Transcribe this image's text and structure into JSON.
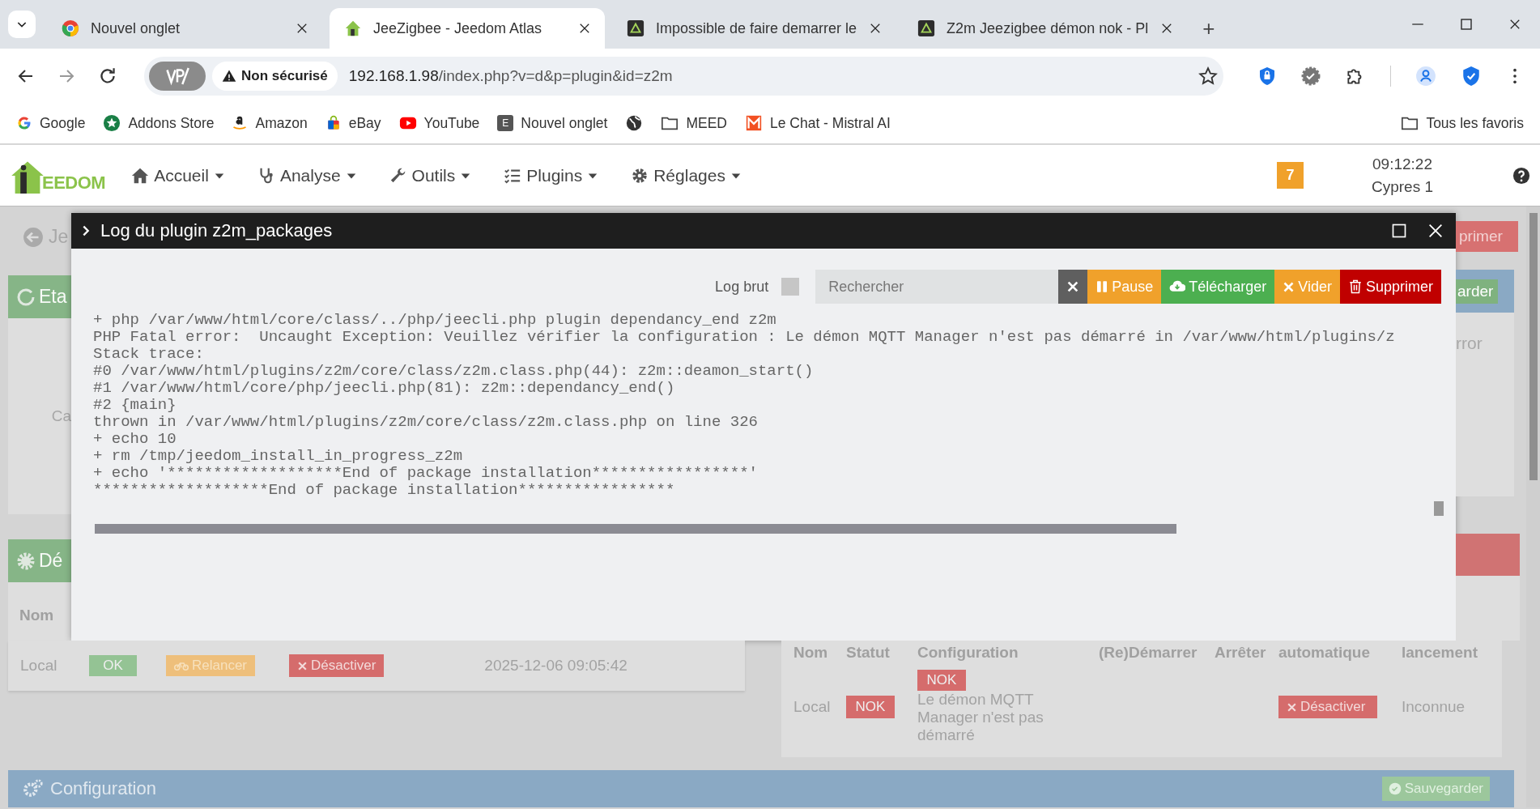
{
  "browser": {
    "tabs": [
      {
        "title": "Nouvel onglet",
        "selected": false
      },
      {
        "title": "JeeZigbee - Jeedom Atlas",
        "selected": true
      },
      {
        "title": "Impossible de faire demarrer le",
        "selected": false
      },
      {
        "title": "Z2m Jeezigbee démon nok - Pl",
        "selected": false
      }
    ],
    "new_tab": "+",
    "security_label": "Non sécurisé",
    "url_host": "192.168.1.98",
    "url_path": "/index.php?v=d&p=plugin&id=z2m",
    "bookmarks": [
      {
        "label": "Google",
        "kind": "google"
      },
      {
        "label": "Addons Store",
        "kind": "addons"
      },
      {
        "label": "Amazon",
        "kind": "amazon"
      },
      {
        "label": "eBay",
        "kind": "ebay"
      },
      {
        "label": "YouTube",
        "kind": "youtube"
      },
      {
        "label": "Nouvel onglet",
        "kind": "letter",
        "icon_text": "E"
      },
      {
        "kind": "globe"
      },
      {
        "label": "MEED",
        "kind": "folder"
      },
      {
        "label": "Le Chat - Mistral AI",
        "kind": "mistral"
      }
    ],
    "all_bookmarks": "Tous les favoris"
  },
  "app": {
    "logo_text": "EEDOM",
    "nav": [
      {
        "label": "Accueil"
      },
      {
        "label": "Analyse"
      },
      {
        "label": "Outils"
      },
      {
        "label": "Plugins"
      },
      {
        "label": "Réglages"
      }
    ],
    "badge": "7",
    "time": "09:12:22",
    "site": "Cypres 1"
  },
  "modal": {
    "title": "Log du plugin z2m_packages",
    "log_raw_label": "Log brut",
    "log_raw_checked": false,
    "search_placeholder": "Rechercher",
    "buttons": [
      {
        "kind": "clear"
      },
      {
        "kind": "pause",
        "label": "Pause"
      },
      {
        "kind": "download",
        "label": "Télécharger"
      },
      {
        "kind": "empty",
        "label": "Vider"
      },
      {
        "kind": "delete",
        "label": "Supprimer"
      }
    ],
    "log_lines": [
      "+ php /var/www/html/core/class/../php/jeecli.php plugin dependancy_end z2m",
      "PHP Fatal error:  Uncaught Exception: Veuillez vérifier la configuration : Le démon MQTT Manager n'est pas démarré in /var/www/html/plugins/z",
      "Stack trace:",
      "#0 /var/www/html/plugins/z2m/core/class/z2m.class.php(44): z2m::deamon_start()",
      "#1 /var/www/html/core/php/jeecli.php(81): z2m::dependancy_end()",
      "#2 {main}",
      "thrown in /var/www/html/plugins/z2m/core/class/z2m.class.php on line 326",
      "+ echo 10",
      "+ rm /tmp/jeedom_install_in_progress_z2m",
      "+ echo '*******************End of package installation*****************'",
      "*******************End of package installation*****************"
    ]
  },
  "background": {
    "back_link": "Je",
    "status_panel": {
      "title": "Eta",
      "text": "Ca"
    },
    "deps_panel": {
      "title": "Dé",
      "column": "Nom",
      "row": {
        "name": "Local",
        "status": "OK",
        "ok": true,
        "restart": "Relancer",
        "disable": "Désactiver",
        "date": "2025-12-06 09:05:42"
      }
    },
    "delete_button": "primer",
    "config_top": {
      "button": "arder",
      "text": "rror"
    },
    "daemon_panel": {
      "columns": [
        "Nom",
        "Statut",
        "Configuration",
        "(Re)Démarrer",
        "Arrêter",
        "automatique",
        "lancement"
      ],
      "row": {
        "name": "Local",
        "status": "NOK",
        "ok": false,
        "config_status": "NOK",
        "config_ok": false,
        "config_text": "Le démon MQTT Manager n'est pas démarré",
        "disable": "Désactiver",
        "last_launch": "Inconnue"
      }
    },
    "configuration": {
      "title": "Configuration",
      "save": "Sauvegarder"
    }
  }
}
